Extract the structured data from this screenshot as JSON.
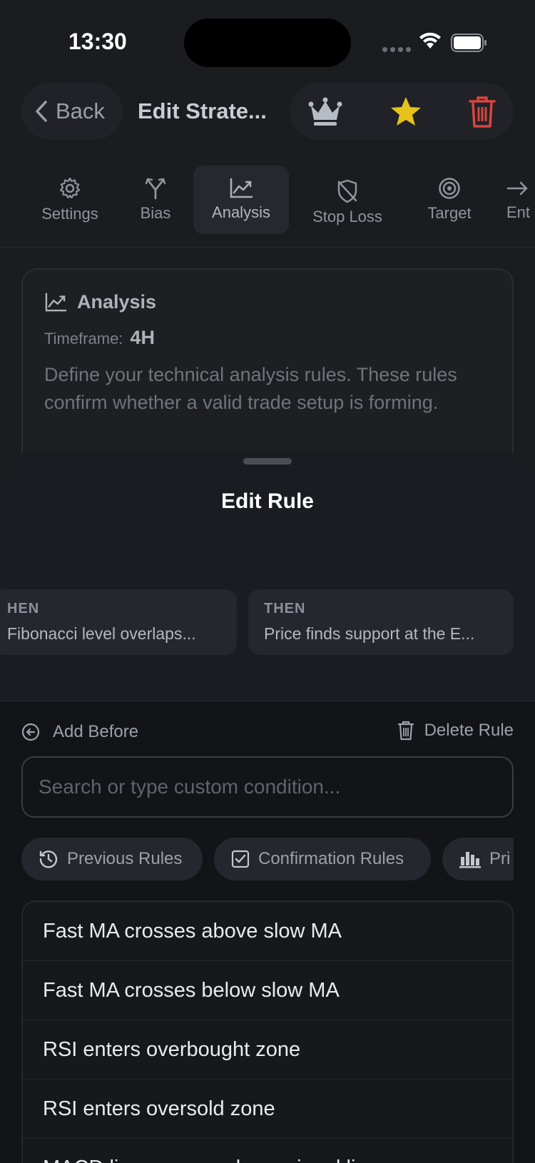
{
  "status": {
    "time": "13:30"
  },
  "header": {
    "back_label": "Back",
    "title": "Edit Strate...",
    "icons": [
      "crown-icon",
      "star-icon",
      "trash-icon"
    ],
    "colors": {
      "star": "#e6c21a",
      "trash": "#d9453f"
    }
  },
  "tabs": [
    {
      "label": "Settings",
      "icon": "gear-icon"
    },
    {
      "label": "Bias",
      "icon": "branch-icon"
    },
    {
      "label": "Analysis",
      "icon": "chart-line-icon",
      "active": true
    },
    {
      "label": "Stop Loss",
      "icon": "shield-off-icon"
    },
    {
      "label": "Target",
      "icon": "target-icon"
    },
    {
      "label": "Ent",
      "icon": "arrow-right-icon"
    }
  ],
  "analysis_card": {
    "title": "Analysis",
    "timeframe_label": "Timeframe:",
    "timeframe_value": "4H",
    "description": "Define your technical analysis rules. These rules confirm whether a valid trade setup is forming."
  },
  "sheet": {
    "title": "Edit Rule",
    "rule_cards": [
      {
        "label": "HEN",
        "text": "Fibonacci level overlaps..."
      },
      {
        "label": "THEN",
        "text": "Price finds support at the E..."
      }
    ],
    "add_before_label": "Add Before",
    "delete_rule_label": "Delete Rule",
    "search_placeholder": "Search or type custom condition...",
    "chips": [
      {
        "label": "Previous Rules",
        "icon": "history-icon"
      },
      {
        "label": "Confirmation Rules",
        "icon": "checkbox-icon"
      },
      {
        "label": "Pri",
        "icon": "bar-chart-icon"
      }
    ],
    "rules": [
      "Fast MA crosses above slow MA",
      "Fast MA crosses below slow MA",
      "RSI enters overbought zone",
      "RSI enters oversold zone",
      "MACD line crosses above signal line"
    ]
  }
}
